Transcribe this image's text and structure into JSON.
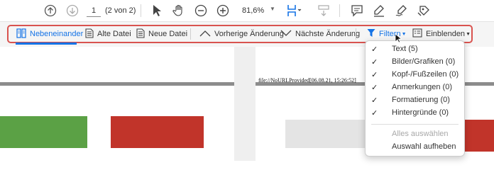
{
  "toolbar": {
    "page_current": "1",
    "page_count": "(2 von 2)",
    "zoom": "81,6%",
    "icons": [
      "arrow-up-circle-icon",
      "arrow-down-circle-icon",
      "select-cursor-icon",
      "hand-icon",
      "zoom-out-icon",
      "zoom-in-icon",
      "scroll-mode-icon",
      "page-fit-icon",
      "comment-icon",
      "highlight-pen-icon",
      "sign-icon",
      "stamp-icon"
    ]
  },
  "compare_bar": {
    "side_by_side": "Nebeneinander",
    "old_file": "Alte Datei",
    "new_file": "Neue Datei",
    "prev_change": "Vorherige Änderung",
    "next_change": "Nächste Änderung",
    "filter": "Filtern",
    "show": "Einblenden",
    "accent_color": "#1473e6",
    "highlight_color": "#d9534f"
  },
  "document": {
    "right_header_text": "file://NoURLProvided[06.08.21, 15:26:52]",
    "colors": {
      "green": "#5ba145",
      "red": "#c1342a",
      "gray": "#e4e4e4"
    }
  },
  "filter_menu": {
    "items": [
      {
        "label": "Text (5)",
        "checked": true,
        "check": "✓"
      },
      {
        "label": "Bilder/Grafiken (0)",
        "checked": true,
        "check": "✓"
      },
      {
        "label": "Kopf-/Fußzeilen (0)",
        "checked": true,
        "check": "✓"
      },
      {
        "label": "Anmerkungen (0)",
        "checked": true,
        "check": "✓"
      },
      {
        "label": "Formatierung (0)",
        "checked": true,
        "check": "✓"
      },
      {
        "label": "Hintergründe (0)",
        "checked": true,
        "check": "✓"
      }
    ],
    "select_all": "Alles auswählen",
    "deselect_all": "Auswahl aufheben"
  }
}
